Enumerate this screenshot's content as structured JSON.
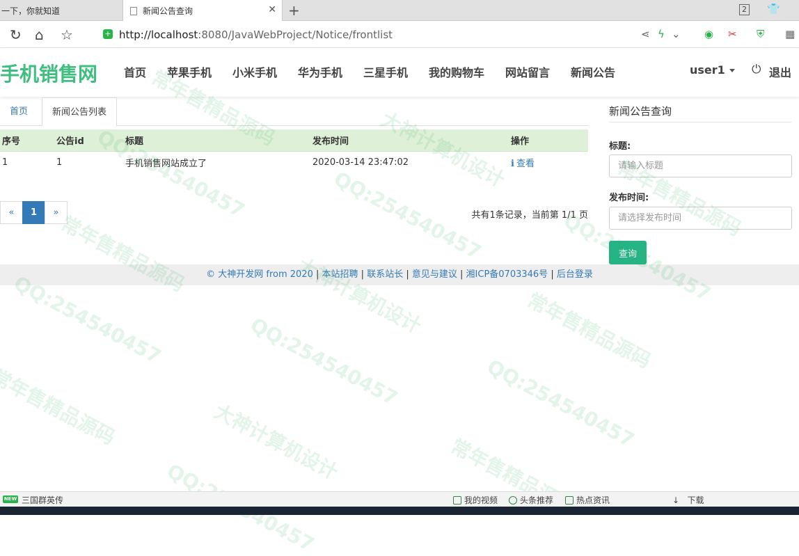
{
  "browser": {
    "tabs": [
      {
        "title": "一下，你就知道"
      },
      {
        "title": "新闻公告查询"
      }
    ],
    "tab_count": "2",
    "url_host": "http://localhost",
    "url_rest": ":8080/JavaWebProject/Notice/frontlist"
  },
  "site": {
    "brand": "手机销售网",
    "menu": [
      "首页",
      "苹果手机",
      "小米手机",
      "华为手机",
      "三星手机",
      "我的购物车",
      "网站留言",
      "新闻公告"
    ],
    "user": "user1",
    "logout": "退出"
  },
  "content": {
    "breadcrumb_home": "首页",
    "breadcrumb_current": "新闻公告列表",
    "columns": [
      "序号",
      "公告id",
      "标题",
      "发布时间",
      "操作"
    ],
    "rows": [
      {
        "index": "1",
        "id": "1",
        "title": "手机销售网站成立了",
        "time": "2020-03-14 23:47:02",
        "action": "查看"
      }
    ],
    "pager": {
      "prev": "«",
      "current": "1",
      "next": "»",
      "info": "共有1条记录，当前第 1/1 页"
    }
  },
  "search": {
    "title": "新闻公告查询",
    "title_label": "标题:",
    "title_placeholder": "请输入标题",
    "time_label": "发布时间:",
    "time_placeholder": "请选择发布时间",
    "button": "查询"
  },
  "footer": {
    "copyright": "© 大神开发网 from 2020",
    "links": [
      "本站招聘",
      "联系站长",
      "意见与建议",
      "湘ICP备0703346号",
      "后台登录"
    ]
  },
  "watermarks": [
    "QQ:254540457",
    "大神计算机设计",
    "常年售精品源码"
  ],
  "statusbar": {
    "left": "三国群英传",
    "items": [
      "我的视频",
      "头条推荐",
      "热点资讯",
      "下载"
    ]
  },
  "colors": {
    "brand": "#3fbf7f",
    "table_header": "#dff0d8",
    "link": "#337ab7",
    "button": "#26b386"
  }
}
